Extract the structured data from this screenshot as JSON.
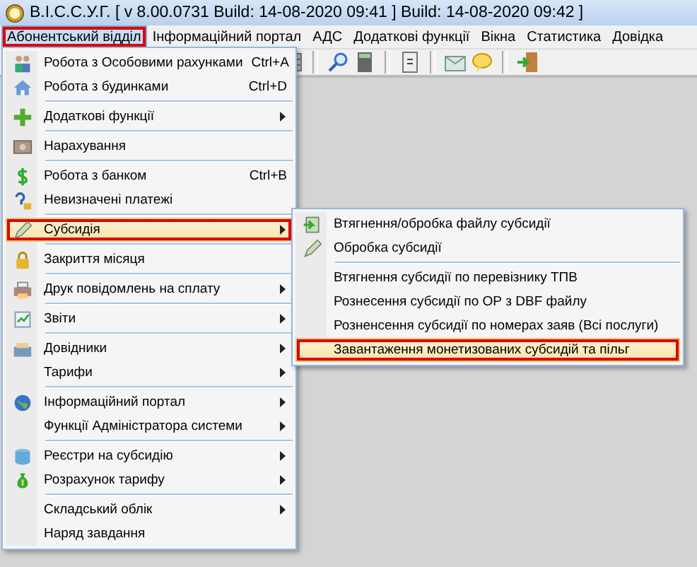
{
  "window": {
    "title": "В.І.С.С.У.Г. [ v 8.00.0731 Build: 14-08-2020 09:41 ]   Build: 14-08-2020 09:42 ]"
  },
  "menubar": [
    {
      "label": "Абонентський відділ",
      "selected": true,
      "outlined": true
    },
    {
      "label": "Інформаційний портал",
      "selected": false,
      "outlined": false
    },
    {
      "label": "АДС",
      "selected": false,
      "outlined": false
    },
    {
      "label": "Додаткові функції",
      "selected": false,
      "outlined": false
    },
    {
      "label": "Вікна",
      "selected": false,
      "outlined": false
    },
    {
      "label": "Статистика",
      "selected": false,
      "outlined": false
    },
    {
      "label": "Довідка",
      "selected": false,
      "outlined": false
    }
  ],
  "menu": {
    "groups": [
      [
        {
          "label": "Робота з Особовими рахунками",
          "shortcut": "Ctrl+A",
          "selected": false,
          "outlined": false
        },
        {
          "label": "Робота з будинками",
          "shortcut": "Ctrl+D",
          "selected": false,
          "outlined": false
        }
      ],
      [
        {
          "label": "Додаткові функції",
          "submenu": true,
          "selected": false,
          "outlined": false
        }
      ],
      [
        {
          "label": "Нарахування",
          "submenu": false,
          "selected": false,
          "outlined": false
        }
      ],
      [
        {
          "label": "Робота з банком",
          "shortcut": "Ctrl+B",
          "selected": false,
          "outlined": false
        },
        {
          "label": "Невизначені платежі",
          "submenu": false,
          "selected": false,
          "outlined": false
        }
      ],
      [
        {
          "label": "Субсидія",
          "submenu": true,
          "selected": true,
          "outlined": true
        }
      ],
      [
        {
          "label": "Закриття місяця",
          "submenu": false,
          "selected": false,
          "outlined": false
        }
      ],
      [
        {
          "label": "Друк повідомлень на сплату",
          "submenu": true,
          "selected": false,
          "outlined": false
        }
      ],
      [
        {
          "label": "Звіти",
          "submenu": true,
          "selected": false,
          "outlined": false
        }
      ],
      [
        {
          "label": "Довідники",
          "submenu": true,
          "selected": false,
          "outlined": false
        },
        {
          "label": "Тарифи",
          "submenu": true,
          "selected": false,
          "outlined": false
        }
      ],
      [
        {
          "label": "Інформаційний портал",
          "submenu": true,
          "selected": false,
          "outlined": false
        },
        {
          "label": "Функції Адміністратора системи",
          "submenu": true,
          "selected": false,
          "outlined": false
        }
      ],
      [
        {
          "label": "Реєстри на субсидію",
          "submenu": true,
          "selected": false,
          "outlined": false
        },
        {
          "label": "Розрахунок тарифу",
          "submenu": true,
          "selected": false,
          "outlined": false
        }
      ],
      [
        {
          "label": "Складський облік",
          "submenu": true,
          "selected": false,
          "outlined": false
        },
        {
          "label": "Наряд завдання",
          "submenu": false,
          "selected": false,
          "outlined": false
        }
      ]
    ]
  },
  "submenu": {
    "groups": [
      [
        {
          "label": "Втягнення/обробка файлу субсидії",
          "selected": false,
          "outlined": false
        },
        {
          "label": "Обробка субсидії",
          "selected": false,
          "outlined": false
        }
      ],
      [
        {
          "label": "Втягнення субсидії по перевізнику ТПВ",
          "selected": false,
          "outlined": false
        },
        {
          "label": "Рознесення субсидії по ОР з DBF файлу",
          "selected": false,
          "outlined": false
        },
        {
          "label": "Розненсення субсидії по номерах заяв (Всі послуги)",
          "selected": false,
          "outlined": false
        },
        {
          "label": "Завантаження монетизованих субсидій та пільг",
          "selected": true,
          "outlined": true
        }
      ]
    ]
  }
}
